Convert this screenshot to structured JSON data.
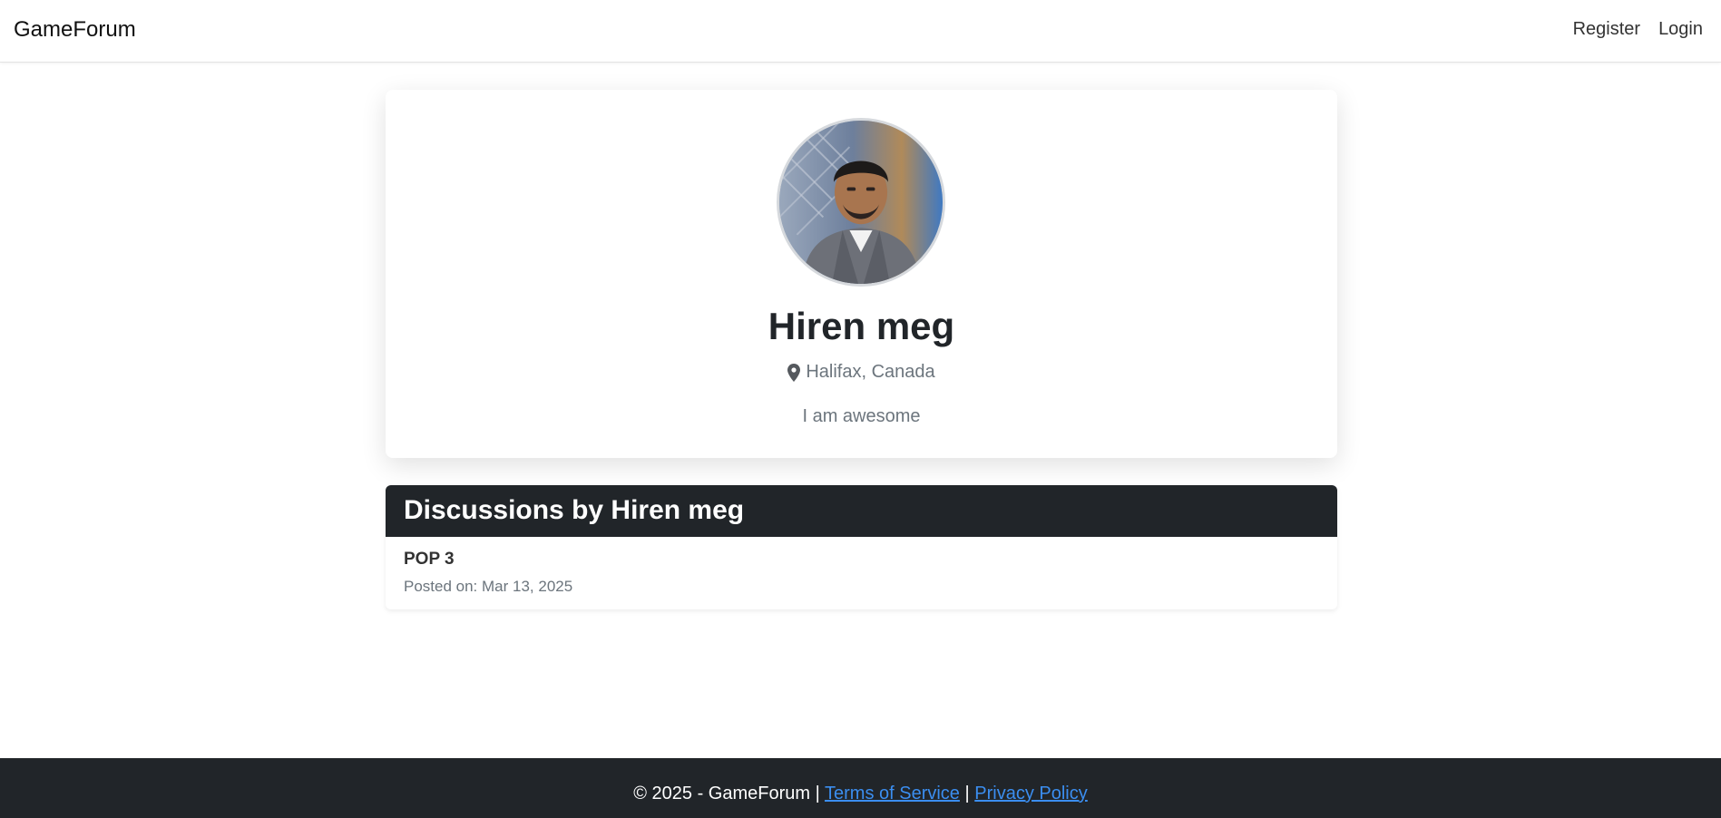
{
  "navbar": {
    "brand": "GameForum",
    "links": [
      "Register",
      "Login"
    ]
  },
  "profile": {
    "name": "Hiren meg",
    "location": "Halifax, Canada",
    "bio": "I am awesome",
    "avatar_icon": "user-photo"
  },
  "discussions": {
    "heading": "Discussions by Hiren meg",
    "items": [
      {
        "title": "POP 3",
        "date": "Posted on: Mar 13, 2025"
      }
    ]
  },
  "footer": {
    "copyright": "© 2025 - GameForum |",
    "terms": "Terms of Service",
    "separator": "|",
    "privacy": "Privacy Policy"
  },
  "colors": {
    "dark": "#212529",
    "muted": "#6c757d",
    "link": "#3b8ef0"
  }
}
